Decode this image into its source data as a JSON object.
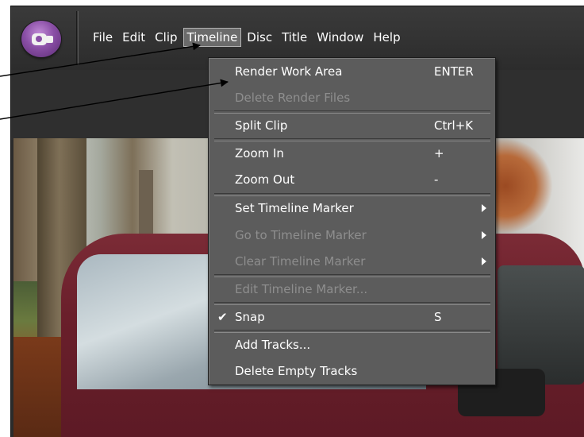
{
  "menubar": {
    "items": [
      {
        "label": "File"
      },
      {
        "label": "Edit"
      },
      {
        "label": "Clip"
      },
      {
        "label": "Timeline"
      },
      {
        "label": "Disc"
      },
      {
        "label": "Title"
      },
      {
        "label": "Window"
      },
      {
        "label": "Help"
      }
    ],
    "active": "Timeline"
  },
  "timeline_menu": {
    "items": [
      {
        "label": "Render Work Area",
        "shortcut": "ENTER",
        "enabled": true
      },
      {
        "label": "Delete Render Files",
        "shortcut": "",
        "enabled": false
      },
      {
        "label": "Split Clip",
        "shortcut": "Ctrl+K",
        "enabled": true
      },
      {
        "label": "Zoom In",
        "shortcut": "+",
        "enabled": true
      },
      {
        "label": "Zoom Out",
        "shortcut": "-",
        "enabled": true
      },
      {
        "label": "Set Timeline Marker",
        "shortcut": "",
        "enabled": true,
        "submenu": true
      },
      {
        "label": "Go to Timeline Marker",
        "shortcut": "",
        "enabled": false,
        "submenu": true
      },
      {
        "label": "Clear Timeline Marker",
        "shortcut": "",
        "enabled": false,
        "submenu": true
      },
      {
        "label": "Edit Timeline Marker...",
        "shortcut": "",
        "enabled": false
      },
      {
        "label": "Snap",
        "shortcut": "S",
        "enabled": true,
        "checked": true
      },
      {
        "label": "Add Tracks...",
        "shortcut": "",
        "enabled": true
      },
      {
        "label": "Delete Empty Tracks",
        "shortcut": "",
        "enabled": true
      }
    ]
  },
  "icons": {
    "app_logo": "camcorder-icon",
    "check": "checkmark-icon",
    "submenu": "chevron-right-icon"
  },
  "colors": {
    "menu_bg": "#5c5c5c",
    "menubar_bg": "#2c2c2c",
    "text": "#ffffff",
    "disabled_text": "#8e8e8e",
    "active_highlight": "#6b6b6b"
  }
}
